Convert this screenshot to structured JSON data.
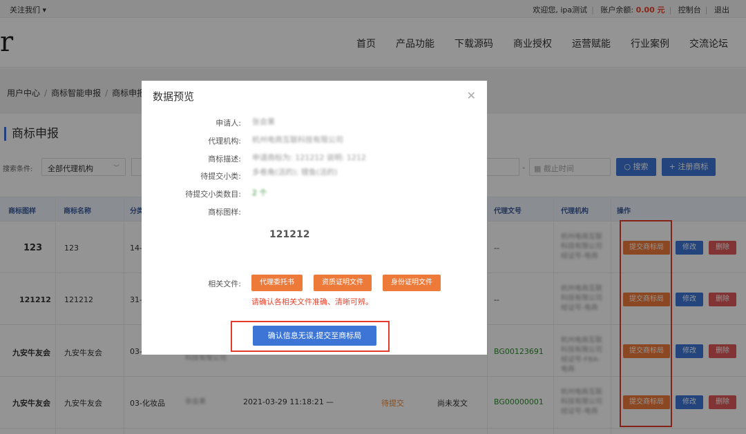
{
  "topbar": {
    "follow": "关注我们",
    "welcome": "欢迎您,",
    "username": "ipa测试",
    "balance_label": "账户余额:",
    "balance_value": "0.00 元",
    "console": "控制台",
    "logout": "退出"
  },
  "header": {
    "logo": "r",
    "nav": [
      "首页",
      "产品功能",
      "下载源码",
      "商业授权",
      "运营赋能",
      "行业案例",
      "交流论坛"
    ]
  },
  "breadcrumb": [
    "用户中心",
    "商标智能申报",
    "商标申报"
  ],
  "page_title": "商标申报",
  "search": {
    "label": "搜索条件:",
    "agency_select": "全部代理机构",
    "date_end_placeholder": "截止时间",
    "search_button": "搜索",
    "register_button": "+ 注册商标"
  },
  "table": {
    "columns": [
      "商标图样",
      "商标名称",
      "分类",
      "代理文号",
      "代理机构",
      "操作"
    ],
    "rows": [
      {
        "sample": "123",
        "name": "123",
        "category": "14-",
        "doc_no": "--",
        "agency": "杭州电商互联科技有限公司 经证号-电商"
      },
      {
        "sample": "121212",
        "name": "121212",
        "category": "31-",
        "doc_no": "--",
        "agency": "杭州电商互联科技有限公司 经证号-电商"
      },
      {
        "sample": "九安牛友会",
        "name": "九安牛友会",
        "category": "03-",
        "doc_no": "BG00123691",
        "agency": "杭州电商互联科技有限公司 经证号-FBA-电商"
      },
      {
        "sample": "九安牛友会",
        "name": "九安牛友会",
        "category": "03-化妆品",
        "applicant": "张会果",
        "date": "2021-03-29 11:18:21",
        "dash": "—",
        "status": "待提交",
        "send_status": "尚未发文",
        "doc_no": "BG00000001",
        "agency": "杭州电商互联科技有限公司 经证号-电商"
      }
    ],
    "row3_extra": "科技有限公司",
    "actions": {
      "submit": "提交商标局",
      "edit": "修改",
      "delete": "删除"
    }
  },
  "modal": {
    "title": "数据预览",
    "fields": [
      {
        "label": "申请人:",
        "value": "张会果"
      },
      {
        "label": "代理机构:",
        "value": "杭州电商互联科技有限公司"
      },
      {
        "label": "商标描述:",
        "value": "申请商标为: 121212 说明: 1212"
      },
      {
        "label": "待提交小类:",
        "value": "多卷角(活的); 锂鱼(活的)"
      },
      {
        "label": "待提交小类数目:",
        "value": "2 个"
      },
      {
        "label": "商标图样:",
        "value": ""
      }
    ],
    "sample_text": "121212",
    "files_label": "相关文件:",
    "files": [
      "代理委托书",
      "资质证明文件",
      "身份证明文件"
    ],
    "hint": "请确认各相关文件准确、清晰可辨。",
    "confirm": "确认信息无误,提交至商标局"
  }
}
